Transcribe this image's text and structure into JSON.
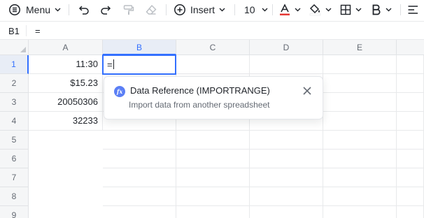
{
  "toolbar": {
    "menu_label": "Menu",
    "insert_label": "Insert",
    "font_size": "10",
    "text_color_accent": "#e53935"
  },
  "formula_bar": {
    "cell_ref": "B1",
    "content": "="
  },
  "grid": {
    "columns": [
      "A",
      "B",
      "C",
      "D",
      "E"
    ],
    "rows": [
      "1",
      "2",
      "3",
      "4",
      "5",
      "6",
      "7",
      "8",
      "9"
    ],
    "cells": {
      "A1": "11:30",
      "A2": "$15.23",
      "A3": "20050306",
      "A4": "32233"
    },
    "active_cell": {
      "ref": "B1",
      "value": "="
    }
  },
  "popup": {
    "badge": "fx",
    "title": "Data Reference (IMPORTRANGE)",
    "description": "Import data from another spreadsheet"
  },
  "colors": {
    "accent": "#3370ff",
    "header_bg": "#f5f6f7",
    "fx_badge": "#5b7ff5"
  }
}
